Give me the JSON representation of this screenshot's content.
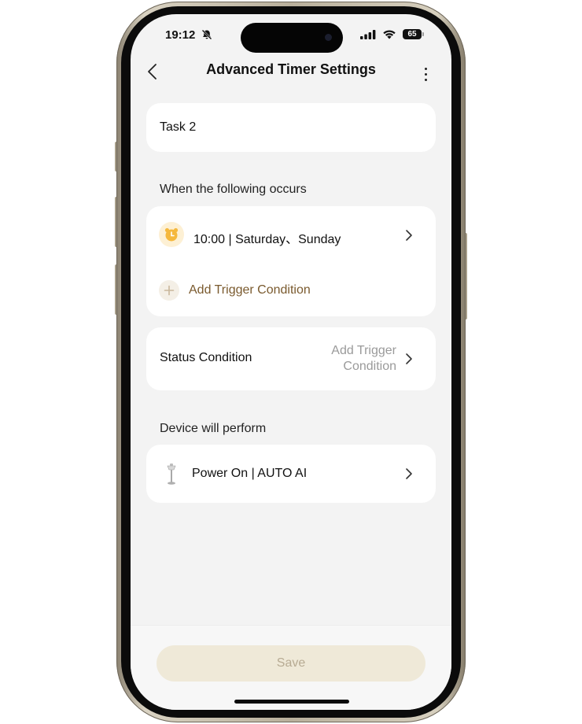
{
  "status_bar": {
    "time": "19:12",
    "battery": "65",
    "icons": [
      "bell-slash-icon",
      "signal-icon",
      "wifi-icon",
      "battery-icon"
    ]
  },
  "header": {
    "title": "Advanced Timer Settings",
    "back_icon": "chevron-left-icon",
    "more_icon": "more-vertical-icon"
  },
  "task": {
    "name": "Task 2"
  },
  "when_section": {
    "label": "When the following occurs",
    "schedule_text": "10:00 | Saturday、Sunday",
    "schedule_icon": "alarm-clock-icon",
    "add_trigger_label": "Add Trigger Condition",
    "add_icon": "plus-icon"
  },
  "status_condition": {
    "label": "Status Condition",
    "value": "Add Trigger Condition"
  },
  "perform_section": {
    "label": "Device will perform",
    "action_text": "Power On | AUTO AI",
    "device_icon": "humidifier-device-icon"
  },
  "footer": {
    "save_label": "Save"
  },
  "colors": {
    "accent_text": "#7a5a2e",
    "save_button_bg": "#efe9d8",
    "alarm_icon": "#f5b83d",
    "screen_bg": "#f3f3f3"
  }
}
